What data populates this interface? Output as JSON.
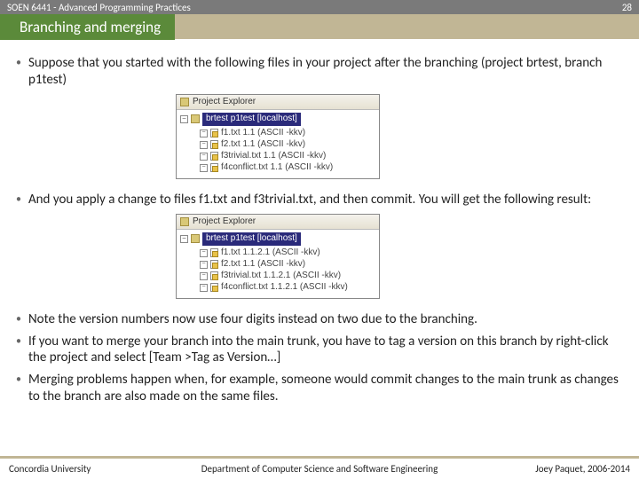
{
  "topbar": {
    "course": "SOEN 6441 - Advanced Programming Practices",
    "page": "28"
  },
  "title": "Branching and merging",
  "bullets": {
    "b1": "Suppose that you started with the following files in your project after the branching (project brtest, branch p1test)",
    "b2": "And you apply a change to files f1.txt and f3trivial.txt, and then commit. You will get the following result:",
    "b3": "Note the version numbers now use four digits instead on two due to the branching.",
    "b4a": "If you want to merge your branch into the main trunk, you have to tag a version on this branch by right-click the project and select ",
    "b4b": "[Team >Tag as Version…]",
    "b5": "Merging problems happen when, for example, someone would commit changes to the main trunk as changes to the branch are also made on the same files."
  },
  "explorer1": {
    "header": "Project Explorer",
    "proj": "brtest p1test [localhost]",
    "files": [
      "f1.txt  1.1  (ASCII -kkv)",
      "f2.txt 1.1 (ASCII -kkv)",
      "f3trivial.txt  1.1  (ASCII -kkv)",
      "f4conflict.txt 1.1  (ASCII -kkv)"
    ]
  },
  "explorer2": {
    "header": "Project Explorer",
    "proj": "brtest p1test [localhost]",
    "files": [
      "f1.txt  1.1.2.1  (ASCII -kkv)",
      "f2.txt 1.1 (ASCII -kkv)",
      "f3trivial.txt  1.1.2.1  (ASCII -kkv)",
      "f4conflict.txt  1.1.2.1  (ASCII -kkv)"
    ]
  },
  "footer": {
    "left": "Concordia University",
    "mid": "Department of Computer Science and Software Engineering",
    "right": "Joey Paquet, 2006-2014"
  }
}
